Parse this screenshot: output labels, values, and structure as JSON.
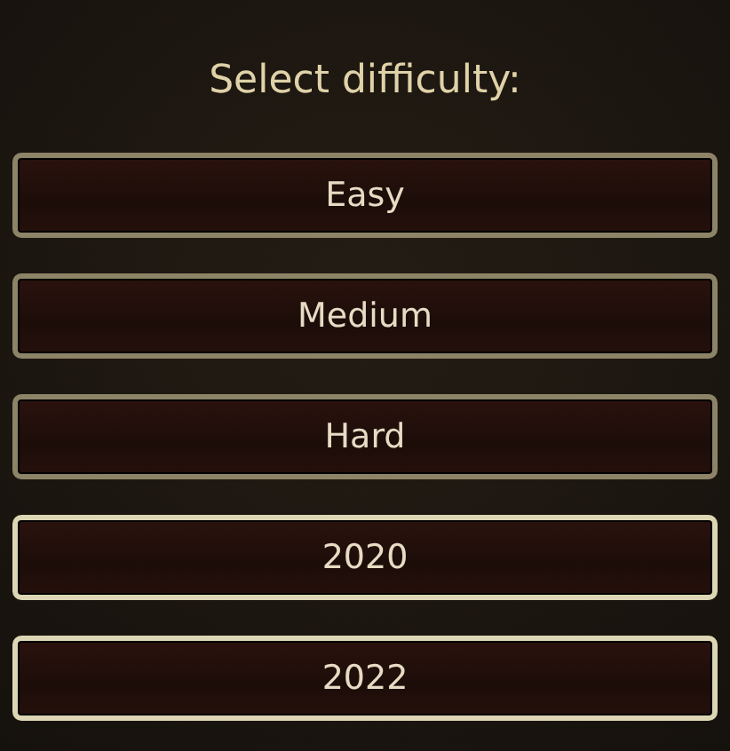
{
  "title": "Select difficulty:",
  "buttons": [
    {
      "label": "Easy",
      "highlighted": false
    },
    {
      "label": "Medium",
      "highlighted": false
    },
    {
      "label": "Hard",
      "highlighted": false
    },
    {
      "label": "2020",
      "highlighted": true
    },
    {
      "label": "2022",
      "highlighted": true
    }
  ]
}
